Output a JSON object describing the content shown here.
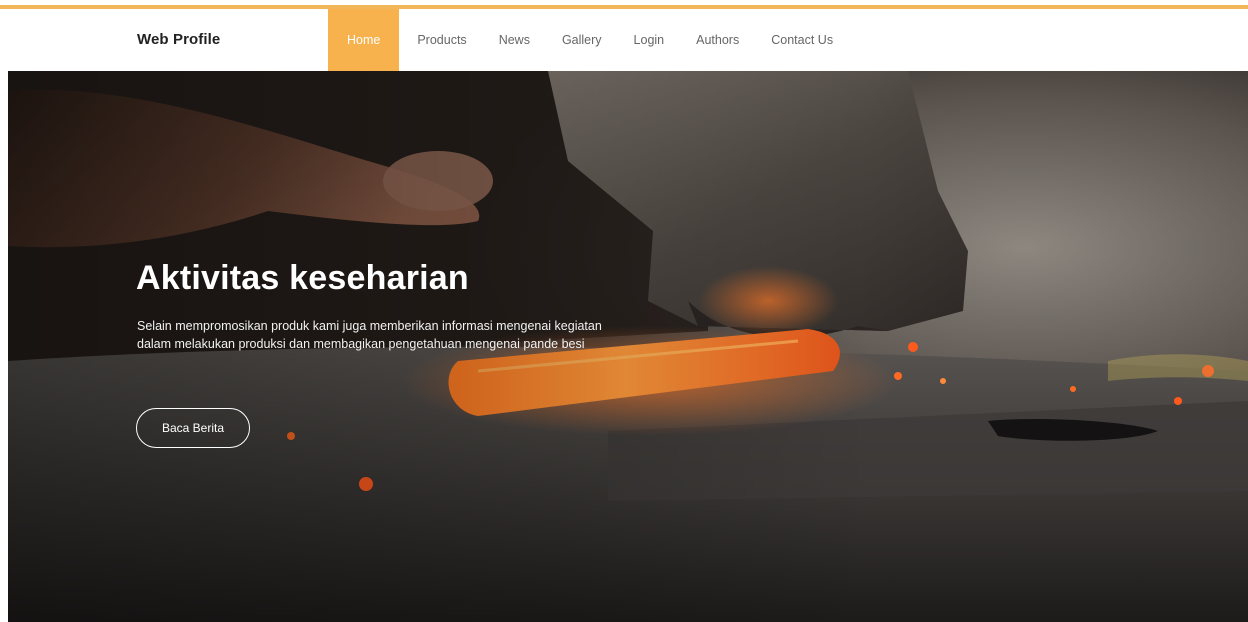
{
  "header": {
    "brand": "Web Profile",
    "nav": [
      "Home",
      "Products",
      "News",
      "Gallery",
      "Login",
      "Authors",
      "Contact Us"
    ],
    "active_nav": "Home"
  },
  "hero": {
    "title": "Aktivitas keseharian",
    "description": "Selain mempromosikan produk kami juga memberikan informasi mengenai kegiatan dalam melakukan produksi dan membagikan pengetahuan mengenai pande besi",
    "button_label": "Baca Berita",
    "image": "blacksmith-hammering-hot-iron"
  },
  "colors": {
    "accent": "#f7b24e",
    "topline": "#f2b65a",
    "nav_text": "#666666",
    "brand_text": "#222222"
  }
}
